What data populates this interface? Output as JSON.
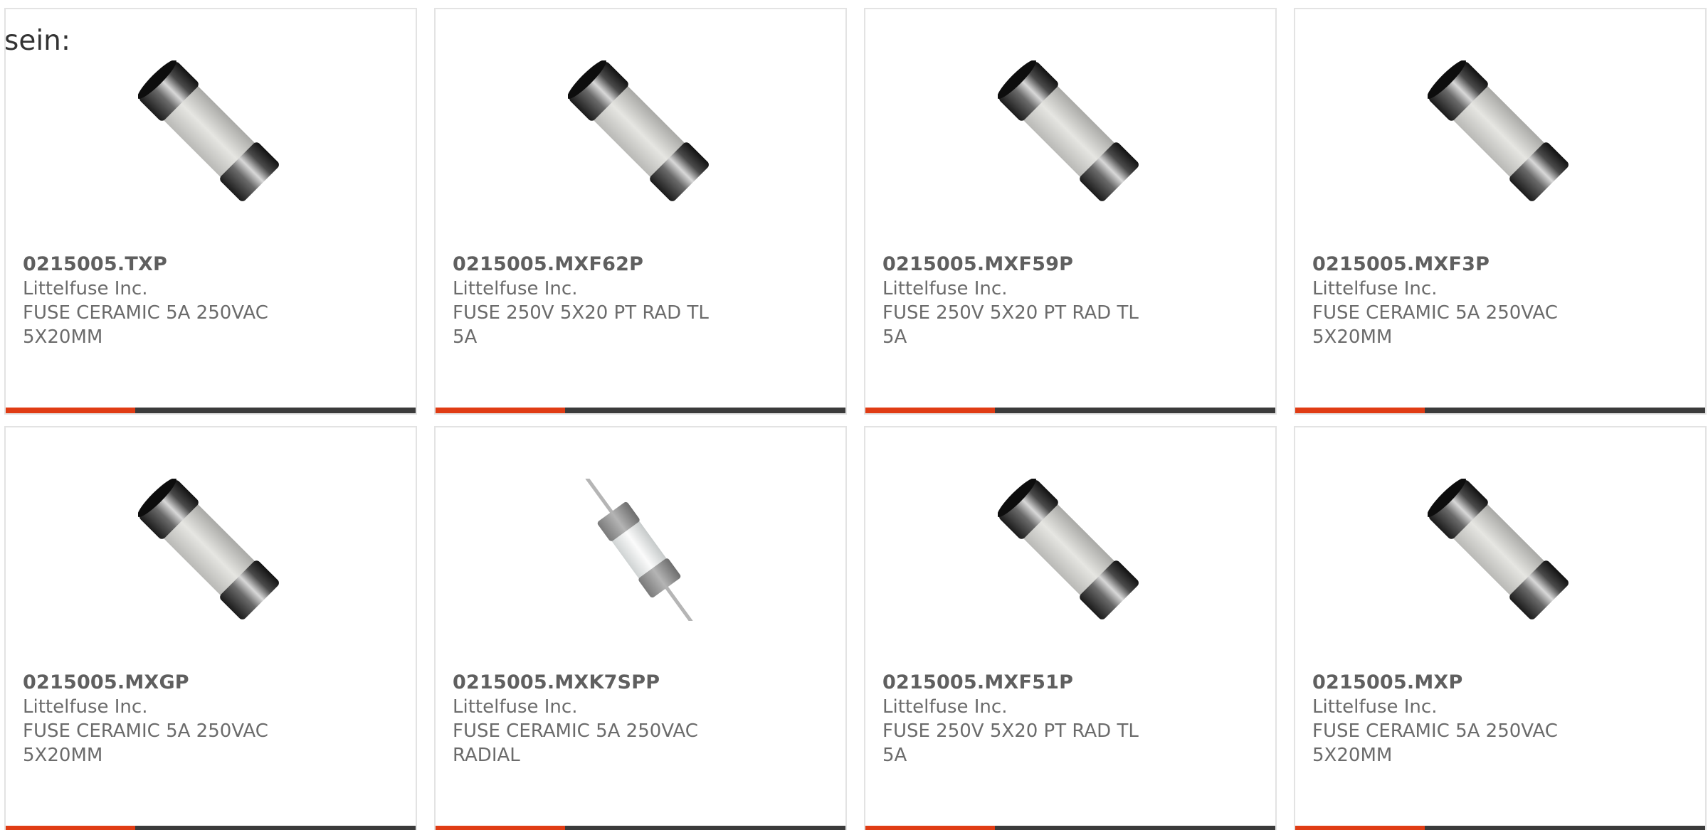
{
  "intro_text": "sein:",
  "colors": {
    "accent": "#e03c14",
    "bar": "#3b3b3b",
    "border": "#e3e3e3",
    "text": "#6b6b6b"
  },
  "products": [
    {
      "part": "0215005.TXP",
      "manufacturer": "Littelfuse Inc.",
      "description": "FUSE CERAMIC 5A 250VAC 5X20MM",
      "image": "cartridge-fuse-icon"
    },
    {
      "part": "0215005.MXF62P",
      "manufacturer": "Littelfuse Inc.",
      "description": "FUSE 250V 5X20 PT RAD TL 5A",
      "image": "cartridge-fuse-icon"
    },
    {
      "part": "0215005.MXF59P",
      "manufacturer": "Littelfuse Inc.",
      "description": "FUSE 250V 5X20 PT RAD TL 5A",
      "image": "cartridge-fuse-icon"
    },
    {
      "part": "0215005.MXF3P",
      "manufacturer": "Littelfuse Inc.",
      "description": "FUSE CERAMIC 5A 250VAC 5X20MM",
      "image": "cartridge-fuse-icon"
    },
    {
      "part": "0215005.MXGP",
      "manufacturer": "Littelfuse Inc.",
      "description": "FUSE CERAMIC 5A 250VAC 5X20MM",
      "image": "cartridge-fuse-icon"
    },
    {
      "part": "0215005.MXK7SPP",
      "manufacturer": "Littelfuse Inc.",
      "description": "FUSE CERAMIC 5A 250VAC RADIAL",
      "image": "axial-lead-fuse-icon"
    },
    {
      "part": "0215005.MXF51P",
      "manufacturer": "Littelfuse Inc.",
      "description": "FUSE 250V 5X20 PT RAD TL 5A",
      "image": "cartridge-fuse-icon"
    },
    {
      "part": "0215005.MXP",
      "manufacturer": "Littelfuse Inc.",
      "description": "FUSE CERAMIC 5A 250VAC 5X20MM",
      "image": "cartridge-fuse-icon"
    }
  ]
}
